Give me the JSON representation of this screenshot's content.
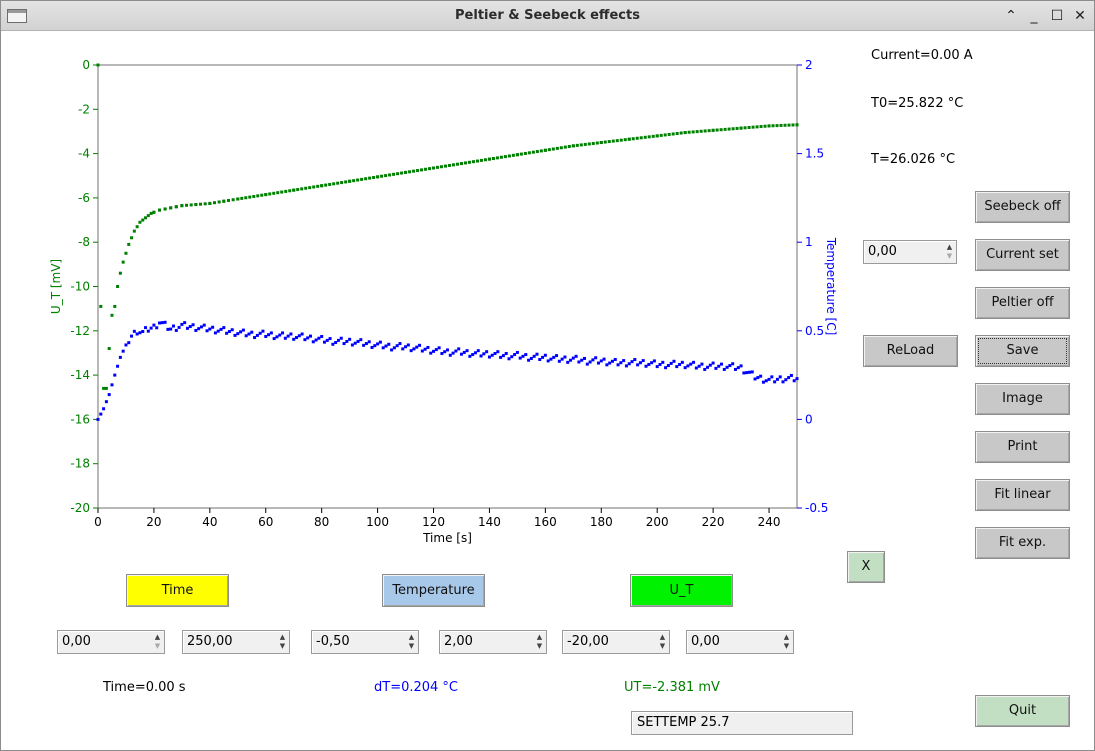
{
  "window": {
    "title": "Peltier & Seebeck effects"
  },
  "status": {
    "current": "Current=0.00 A",
    "t0": "T0=25.822 °C",
    "t": "T=26.026 °C",
    "time_readout": "Time=0.00 s",
    "dt_readout": "dT=0.204 °C",
    "ut_readout": "UT=-2.381 mV"
  },
  "buttons": {
    "seebeck_off": "Seebeck off",
    "current_set": "Current set",
    "peltier_off": "Peltier off",
    "reload": "ReLoad",
    "save": "Save",
    "image": "Image",
    "print": "Print",
    "fit_linear": "Fit linear",
    "fit_exp": "Fit exp.",
    "x": "X",
    "quit": "Quit",
    "time": "Time",
    "temperature": "Temperature",
    "u_t": "U_T"
  },
  "inputs": {
    "current_value": "0,00",
    "time_min": "0,00",
    "time_max": "250,00",
    "temp_min": "-0,50",
    "temp_max": "2,00",
    "ut_min": "-20,00",
    "ut_max": "0,00",
    "command": "SETTEMP 25.7"
  },
  "colors": {
    "ut_series": "#008000",
    "temperature_series": "#0000ff",
    "time_button": "#ffff00",
    "temperature_button": "#a8c8ea",
    "ut_button": "#00f200"
  },
  "chart_data": {
    "type": "scatter",
    "title": "",
    "xlabel": "Time [s]",
    "ylabel": "U_T [mV]",
    "y2label": "Temperature [C]",
    "xlim": [
      0,
      250
    ],
    "ylim": [
      -20,
      0
    ],
    "y2lim": [
      -0.5,
      2
    ],
    "x_ticks": [
      "0",
      "20",
      "40",
      "60",
      "80",
      "100",
      "120",
      "140",
      "160",
      "180",
      "200",
      "220",
      "240"
    ],
    "y_ticks": [
      "0",
      "-2",
      "-4",
      "-6",
      "-8",
      "-10",
      "-12",
      "-14",
      "-16",
      "-18",
      "-20"
    ],
    "y2_ticks": [
      "2",
      "1.5",
      "1",
      "0.5",
      "0",
      "-0.5"
    ],
    "grid": false,
    "series": [
      {
        "axis": "left",
        "color": "#008000",
        "x": [
          0,
          1,
          2,
          3,
          4,
          5,
          6,
          7,
          8,
          9,
          10,
          11,
          12,
          13,
          14,
          15,
          16,
          17,
          18,
          19,
          20,
          22,
          24,
          26,
          28,
          30,
          35,
          40,
          45,
          50,
          60,
          70,
          80,
          90,
          100,
          110,
          120,
          130,
          140,
          150,
          160,
          170,
          180,
          190,
          200,
          210,
          220,
          230,
          240,
          250
        ],
        "y": [
          0.0,
          -10.9,
          -14.6,
          -14.6,
          -12.8,
          -11.3,
          -10.9,
          -10.0,
          -9.4,
          -8.9,
          -8.5,
          -8.1,
          -7.8,
          -7.5,
          -7.3,
          -7.1,
          -7.0,
          -6.9,
          -6.8,
          -6.7,
          -6.65,
          -6.55,
          -6.5,
          -6.45,
          -6.4,
          -6.35,
          -6.3,
          -6.25,
          -6.15,
          -6.05,
          -5.85,
          -5.65,
          -5.45,
          -5.25,
          -5.05,
          -4.85,
          -4.65,
          -4.45,
          -4.25,
          -4.05,
          -3.85,
          -3.65,
          -3.5,
          -3.35,
          -3.2,
          -3.05,
          -2.95,
          -2.85,
          -2.75,
          -2.7
        ]
      },
      {
        "axis": "right",
        "color": "#0000ff",
        "x": [
          0,
          2,
          4,
          6,
          8,
          10,
          12,
          14,
          16,
          18,
          20,
          22,
          24,
          26,
          28,
          30,
          35,
          40,
          45,
          50,
          55,
          60,
          65,
          70,
          75,
          80,
          85,
          90,
          95,
          100,
          105,
          110,
          115,
          120,
          125,
          130,
          135,
          140,
          145,
          150,
          155,
          160,
          165,
          170,
          175,
          180,
          185,
          190,
          195,
          200,
          205,
          210,
          215,
          220,
          225,
          230,
          235,
          240,
          245,
          250
        ],
        "y": [
          0.0,
          0.06,
          0.14,
          0.25,
          0.35,
          0.42,
          0.47,
          0.5,
          0.49,
          0.51,
          0.52,
          0.55,
          0.53,
          0.51,
          0.52,
          0.53,
          0.52,
          0.51,
          0.5,
          0.49,
          0.48,
          0.48,
          0.47,
          0.47,
          0.46,
          0.45,
          0.44,
          0.44,
          0.43,
          0.42,
          0.41,
          0.41,
          0.4,
          0.39,
          0.38,
          0.38,
          0.37,
          0.37,
          0.36,
          0.36,
          0.35,
          0.35,
          0.34,
          0.34,
          0.33,
          0.33,
          0.32,
          0.32,
          0.32,
          0.31,
          0.31,
          0.31,
          0.3,
          0.3,
          0.3,
          0.29,
          0.24,
          0.22,
          0.23,
          0.23
        ]
      }
    ]
  }
}
